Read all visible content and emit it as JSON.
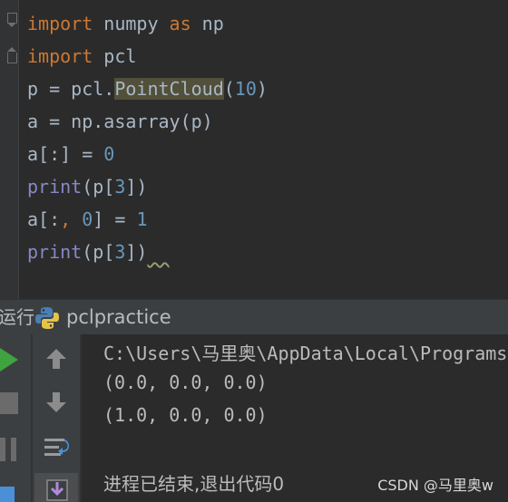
{
  "editor": {
    "lines": [
      [
        {
          "t": "import",
          "c": "kw"
        },
        {
          "t": " numpy "
        },
        {
          "t": "as",
          "c": "kw"
        },
        {
          "t": " np"
        }
      ],
      [
        {
          "t": "import",
          "c": "kw"
        },
        {
          "t": " pcl"
        }
      ],
      [
        {
          "t": "p = pcl."
        },
        {
          "t": "PointCloud",
          "c": "hl"
        },
        {
          "t": "("
        },
        {
          "t": "10",
          "c": "num"
        },
        {
          "t": ")"
        }
      ],
      [
        {
          "t": "a = np.asarray(p)"
        }
      ],
      [
        {
          "t": "a[:] = "
        },
        {
          "t": "0",
          "c": "num"
        }
      ],
      [
        {
          "t": "print",
          "c": "builtin"
        },
        {
          "t": "(p["
        },
        {
          "t": "3",
          "c": "num"
        },
        {
          "t": "])"
        }
      ],
      [
        {
          "t": "a[:"
        },
        {
          "t": ",",
          "c": "kw"
        },
        {
          "t": " "
        },
        {
          "t": "0",
          "c": "num"
        },
        {
          "t": "] = "
        },
        {
          "t": "1",
          "c": "num"
        }
      ],
      [
        {
          "t": "print",
          "c": "builtin"
        },
        {
          "t": "(p["
        },
        {
          "t": "3",
          "c": "num"
        },
        {
          "t": "])"
        },
        {
          "t": "  ",
          "c": "squig"
        }
      ]
    ]
  },
  "run_panel": {
    "title": "运行",
    "config_name": "pclpractice",
    "console": {
      "command": "C:\\Users\\马里奥\\AppData\\Local\\Programs",
      "output": [
        "(0.0, 0.0, 0.0)",
        "(1.0, 0.0, 0.0)"
      ],
      "exit_message": "进程已结束,退出代码0"
    }
  },
  "watermark": "CSDN @马里奥w",
  "colors": {
    "keyword": "#cc7832",
    "number": "#6897bb",
    "builtin": "#8888c6",
    "text": "#a9b7c6",
    "run_green": "#3fa33f"
  }
}
